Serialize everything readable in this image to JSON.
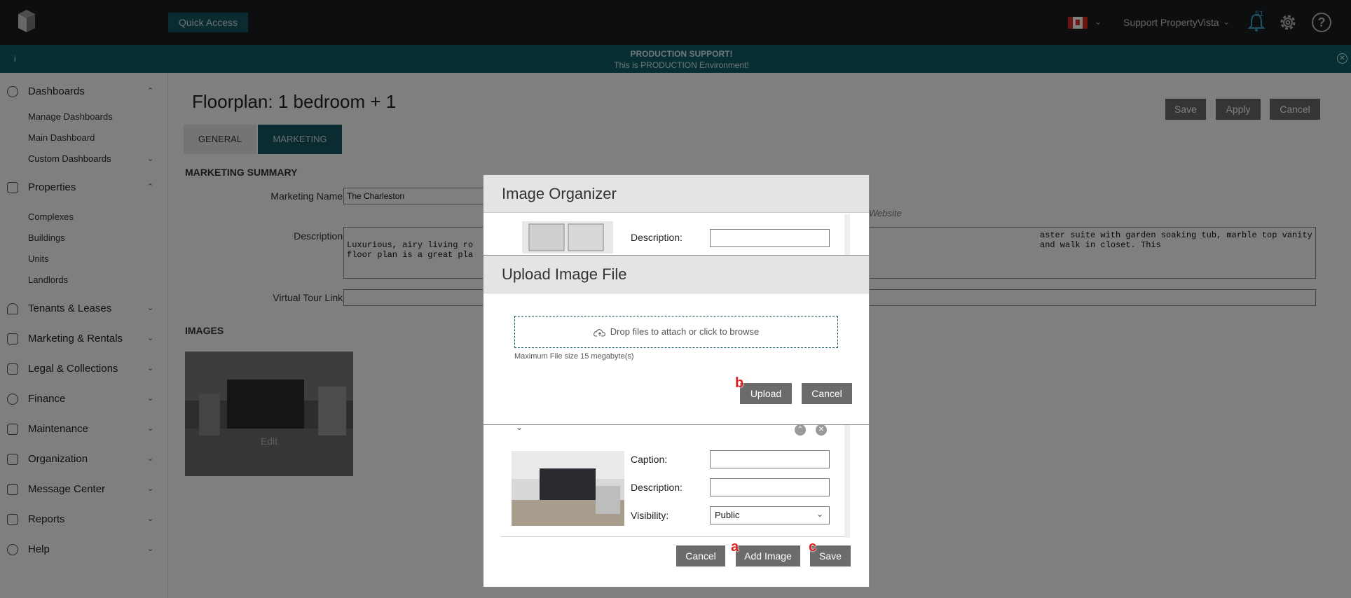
{
  "topbar": {
    "quick_access": "Quick Access",
    "user": "Support PropertyVista",
    "notifications": "51"
  },
  "banner": {
    "info_icon": "i",
    "title": "PRODUCTION SUPPORT!",
    "subtitle": "This is PRODUCTION Environment!"
  },
  "sidebar": {
    "dashboards": "Dashboards",
    "manage_dashboards": "Manage Dashboards",
    "main_dashboard": "Main Dashboard",
    "custom_dashboards": "Custom Dashboards",
    "properties": "Properties",
    "complexes": "Complexes",
    "buildings": "Buildings",
    "units": "Units",
    "landlords": "Landlords",
    "tenants": "Tenants & Leases",
    "marketing": "Marketing & Rentals",
    "legal": "Legal & Collections",
    "finance": "Finance",
    "maintenance": "Maintenance",
    "organization": "Organization",
    "message_center": "Message Center",
    "reports": "Reports",
    "help": "Help"
  },
  "main": {
    "title": "Floorplan: 1 bedroom + 1",
    "save": "Save",
    "apply": "Apply",
    "cancel": "Cancel",
    "tab_general": "GENERAL",
    "tab_marketing": "MARKETING",
    "section_summary": "MARKETING SUMMARY",
    "marketing_name_label": "Marketing Name:",
    "marketing_name_value": "The Charleston",
    "description_label": "Description:",
    "description_left": "Luxurious, airy living ro\nfloor plan is a great pla",
    "description_right": "aster suite with garden soaking tub, marble top vanity and walk in closet. This",
    "website_text": "Website",
    "virtual_tour_label": "Virtual Tour Link:",
    "section_images": "IMAGES",
    "thumb_edit": "Edit"
  },
  "image_organizer": {
    "title": "Image Organizer",
    "description_label": "Description:",
    "caption_label": "Caption:",
    "description_label_2": "Description:",
    "visibility_label": "Visibility:",
    "visibility_value": "Public",
    "cancel": "Cancel",
    "add_image": "Add Image",
    "save": "Save"
  },
  "upload_dialog": {
    "title": "Upload Image File",
    "dropzone_text": "Drop files to attach or click to browse",
    "max_size": "Maximum File size 15 megabyte(s)",
    "upload": "Upload",
    "cancel": "Cancel"
  },
  "markers": {
    "a": "a",
    "b": "b",
    "c": "c"
  },
  "colors": {
    "accent": "#14575e",
    "button": "#6b6b6b",
    "marker": "#e02020"
  }
}
